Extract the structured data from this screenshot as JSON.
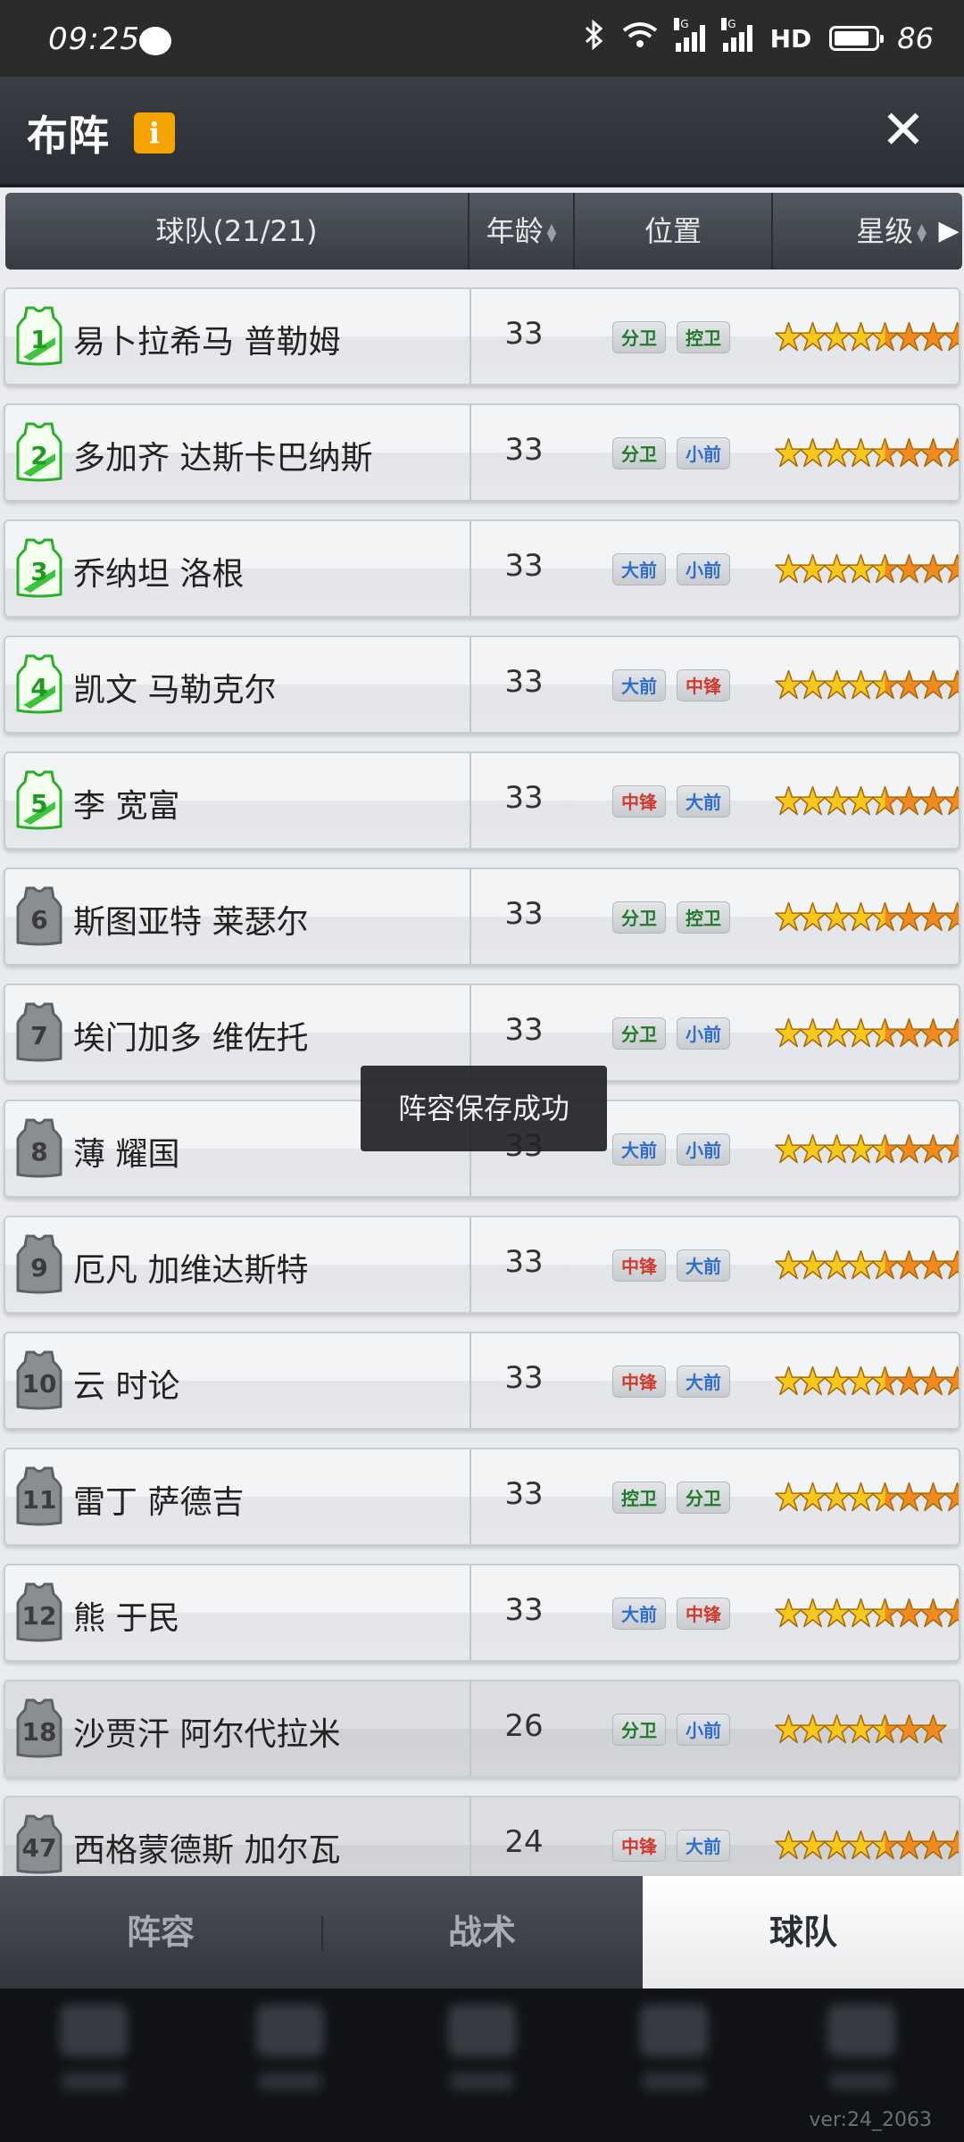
{
  "status_bar": {
    "time": "09:25",
    "signal1_label": "5G",
    "signal2_label": "5G",
    "hd_label": "HD",
    "battery": "86"
  },
  "header": {
    "title": "布阵",
    "info_icon": "i",
    "close_icon": "✕"
  },
  "table": {
    "columns": {
      "team": "球队(21/21)",
      "age": "年龄",
      "position": "位置",
      "stars": "星级"
    },
    "rows": [
      {
        "number": "1",
        "name": "易卜拉希马 普勒姆",
        "age": "33",
        "positions": [
          "分卫",
          "控卫"
        ],
        "starter": true,
        "stars": {
          "gold": 4.5,
          "orange": 3.5
        }
      },
      {
        "number": "2",
        "name": "多加齐 达斯卡巴纳斯",
        "age": "33",
        "positions": [
          "分卫",
          "小前"
        ],
        "starter": true,
        "stars": {
          "gold": 4.5,
          "orange": 3.5
        }
      },
      {
        "number": "3",
        "name": "乔纳坦 洛根",
        "age": "33",
        "positions": [
          "大前",
          "小前"
        ],
        "starter": true,
        "stars": {
          "gold": 4.5,
          "orange": 3.5
        }
      },
      {
        "number": "4",
        "name": "凯文 马勒克尔",
        "age": "33",
        "positions": [
          "大前",
          "中锋"
        ],
        "starter": true,
        "stars": {
          "gold": 4.5,
          "orange": 3.5
        }
      },
      {
        "number": "5",
        "name": "李 宽富",
        "age": "33",
        "positions": [
          "中锋",
          "大前"
        ],
        "starter": true,
        "stars": {
          "gold": 4.5,
          "orange": 3
        }
      },
      {
        "number": "6",
        "name": "斯图亚特 莱瑟尔",
        "age": "33",
        "positions": [
          "分卫",
          "控卫"
        ],
        "starter": false,
        "stars": {
          "gold": 4.5,
          "orange": 3.5
        }
      },
      {
        "number": "7",
        "name": "埃门加多 维佐托",
        "age": "33",
        "positions": [
          "分卫",
          "小前"
        ],
        "starter": false,
        "stars": {
          "gold": 4.5,
          "orange": 3.5
        }
      },
      {
        "number": "8",
        "name": "薄 耀国",
        "age": "33",
        "positions": [
          "大前",
          "小前"
        ],
        "starter": false,
        "stars": {
          "gold": 4.5,
          "orange": 3
        }
      },
      {
        "number": "9",
        "name": "厄凡 加维达斯特",
        "age": "33",
        "positions": [
          "中锋",
          "大前"
        ],
        "starter": false,
        "stars": {
          "gold": 4.5,
          "orange": 3
        }
      },
      {
        "number": "10",
        "name": "云 时论",
        "age": "33",
        "positions": [
          "中锋",
          "大前"
        ],
        "starter": false,
        "stars": {
          "gold": 4.5,
          "orange": 3
        }
      },
      {
        "number": "11",
        "name": "雷丁 萨德吉",
        "age": "33",
        "positions": [
          "控卫",
          "分卫"
        ],
        "starter": false,
        "stars": {
          "gold": 4.5,
          "orange": 3.5
        }
      },
      {
        "number": "12",
        "name": "熊 于民",
        "age": "33",
        "positions": [
          "大前",
          "中锋"
        ],
        "starter": false,
        "stars": {
          "gold": 4.5,
          "orange": 3
        }
      },
      {
        "number": "18",
        "name": "沙贾汗 阿尔代拉米",
        "age": "26",
        "positions": [
          "分卫",
          "小前"
        ],
        "starter": false,
        "stars": {
          "gold": 4.5,
          "orange": 2
        }
      },
      {
        "number": "47",
        "name": "西格蒙德斯 加尔瓦",
        "age": "24",
        "positions": [
          "中锋",
          "大前"
        ],
        "starter": false,
        "stars": {
          "gold": 4.5,
          "orange": 3
        }
      }
    ]
  },
  "toast": "阵容保存成功",
  "tabs": [
    {
      "label": "阵容",
      "active": false
    },
    {
      "label": "战术",
      "active": false
    },
    {
      "label": "球队",
      "active": true
    }
  ],
  "version": "ver:24_2063",
  "colors": {
    "guard_text": "#1f7a2a",
    "forward_text": "#2f6fc9",
    "center_text": "#d03a2f",
    "star_gold": "#f6c81c",
    "star_orange": "#f28a1e",
    "info_badge": "#f5a300"
  },
  "icons": {
    "bluetooth": "bluetooth-icon",
    "wifi": "wifi-icon",
    "close": "close-icon",
    "next": "chevron-right-icon"
  }
}
